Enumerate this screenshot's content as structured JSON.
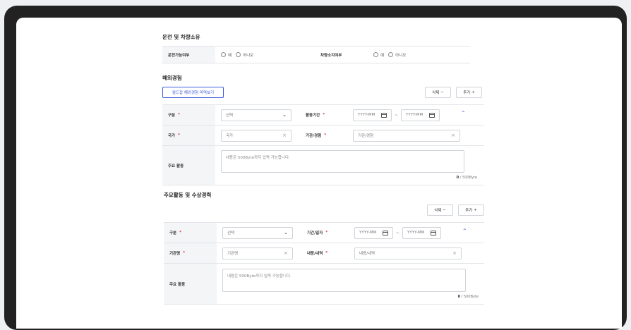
{
  "driving": {
    "title": "운전 및 차량소유",
    "can_drive_label": "운전가능여부",
    "own_car_label": "차량소지여부",
    "yes": "예",
    "no": "아니오"
  },
  "overseas": {
    "title": "해외경험",
    "worldjob_button": "월드잡 해외경험 마역보기",
    "delete_button": "삭제",
    "add_button": "추가",
    "type_label": "구분",
    "type_value": "선택",
    "period_label": "활동기간",
    "date_placeholder": "YYYY-MM",
    "tilde": "~",
    "country_label": "국가",
    "country_placeholder": "국가",
    "org_label": "기관/경험",
    "org_placeholder": "기관/경험",
    "activity_label": "주요 활동",
    "activity_placeholder": "내용은 500Byte까지 입력 가능합니다.",
    "counter_value": "0",
    "counter_unit": "/ 500Byte"
  },
  "awards": {
    "title": "주요활동 및 수상경력",
    "delete_button": "삭제",
    "add_button": "추가",
    "type_label": "구분",
    "type_value": "선택",
    "period_label": "기간/일자",
    "date_placeholder": "YYYY-MM",
    "tilde": "~",
    "org_label": "기관명",
    "org_placeholder": "기관명",
    "content_label": "내용/내역",
    "content_placeholder": "내용/내역",
    "activity_label": "주요 활동",
    "activity_placeholder": "내용은 500Byte까지 입력 가능합니다.",
    "counter_value": "0",
    "counter_unit": "/ 500Byte"
  },
  "symbols": {
    "minus": "−",
    "plus": "+",
    "chevron_down": "⌄",
    "chevron_up": "⌃",
    "clear": "×",
    "required": "*"
  }
}
